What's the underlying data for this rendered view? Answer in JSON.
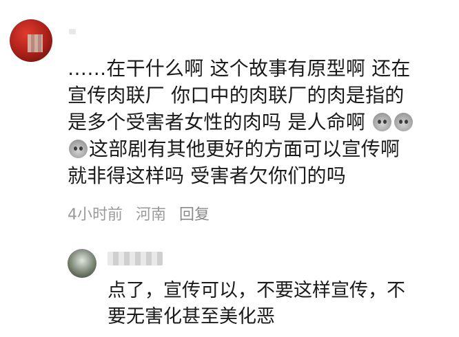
{
  "comment": {
    "lines": [
      "……在干什么啊 这个故事有原型啊  还在",
      "宣传肉联厂 你口中的肉联厂的肉是指的",
      "是多个受害者女性的肉吗 是人命啊",
      "这部剧有其他更好的方面可以宣传啊",
      "就非得这样吗 受害者欠你们的吗"
    ],
    "emoji_icon": "sad-face-emoji-icon"
  },
  "meta": {
    "time": "4小时前",
    "location": "河南",
    "reply_label": "回复"
  },
  "reply": {
    "lines": [
      "点了，宣传可以，不要这样宣传，不",
      "要无害化甚至美化恶"
    ]
  },
  "colors": {
    "text": "#1a1a1a",
    "meta": "#9a9a9a",
    "avatar_accent": "#e23b2f"
  }
}
